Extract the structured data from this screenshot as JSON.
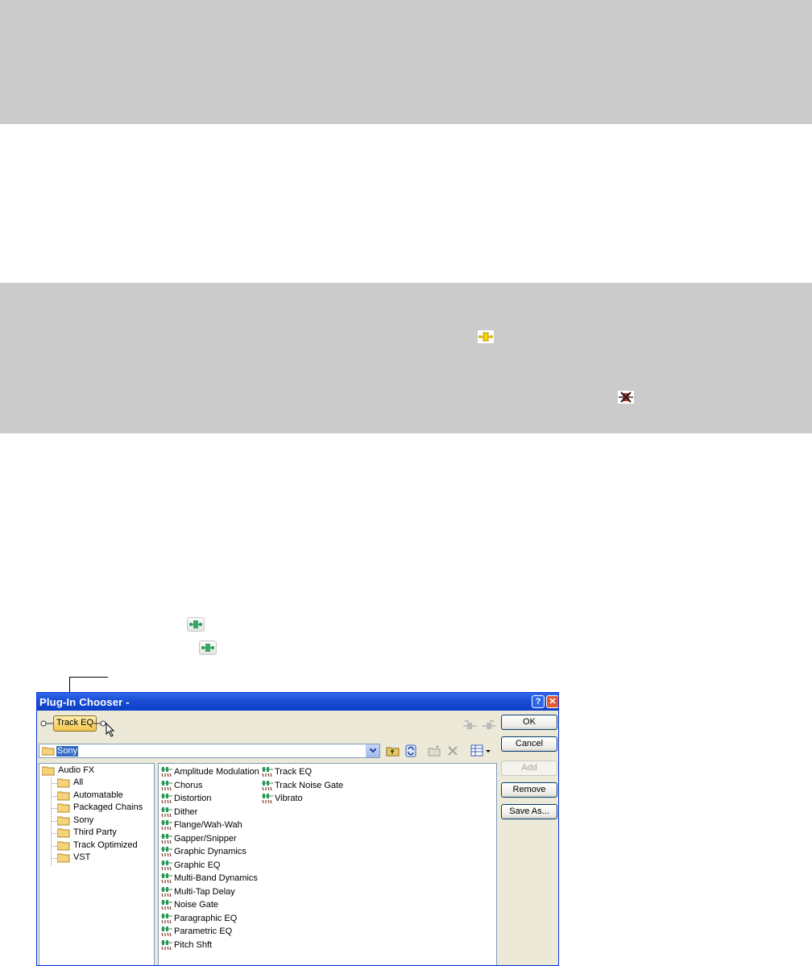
{
  "dialog": {
    "title": "Plug-In Chooser -",
    "help_label": "?",
    "close_label": "✕",
    "chain_item": "Track EQ",
    "combo_value": "Sony",
    "buttons": {
      "ok": "OK",
      "cancel": "Cancel",
      "add": "Add",
      "remove": "Remove",
      "save_as": "Save As..."
    },
    "tree": {
      "root": "Audio FX",
      "children": [
        "All",
        "Automatable",
        "Packaged Chains",
        "Sony",
        "Third Party",
        "Track Optimized",
        "VST"
      ]
    },
    "plugins_col1": [
      "Amplitude Modulation",
      "Chorus",
      "Distortion",
      "Dither",
      "Flange/Wah-Wah",
      "Gapper/Snipper",
      "Graphic Dynamics",
      "Graphic EQ",
      "Multi-Band Dynamics",
      "Multi-Tap Delay",
      "Noise Gate",
      "Paragraphic EQ",
      "Parametric EQ",
      "Pitch Shft"
    ],
    "plugins_col2": [
      "Track EQ",
      "Track Noise Gate",
      "Vibrato"
    ]
  },
  "colors": {
    "band": "#cbcbcb",
    "titlebar": "#0c3ec7",
    "selection": "#316ac5",
    "chain_box": "#f2c44a"
  }
}
